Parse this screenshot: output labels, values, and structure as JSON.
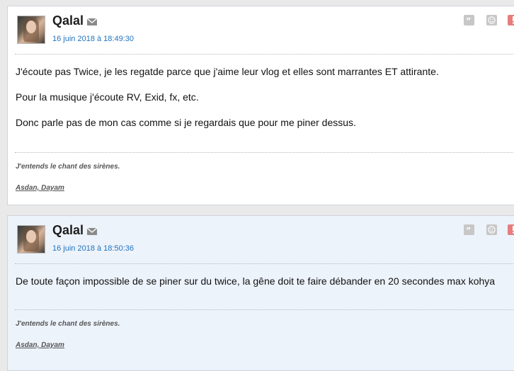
{
  "posts": [
    {
      "author": "Qalal",
      "date": "16 juin 2018 à 18:49:30",
      "paragraphs": [
        "J'écoute pas Twice, je les regatde parce que j'aime leur vlog et elles sont marrantes ET attirante.",
        "Pour la musique j'écoute RV, Exid, fx, etc.",
        "Donc parle pas de mon cas comme si je regardais que pour me piner dessus."
      ],
      "signature": "J'entends le chant des sirènes.",
      "signature_link": "Asdan, Dayam",
      "icons": [
        "mail-icon",
        "quote-icon",
        "sad-icon",
        "alert-icon"
      ]
    },
    {
      "author": "Qalal",
      "date": "16 juin 2018 à 18:50:36",
      "paragraphs": [
        "De toute façon impossible de se piner sur du twice, la gêne doit te faire débander en 20 secondes max kohya"
      ],
      "signature": "J'entends le chant des sirènes.",
      "signature_link": "Asdan, Dayam",
      "icons": [
        "mail-icon",
        "quote-icon",
        "sad-icon",
        "alert-icon"
      ]
    }
  ]
}
